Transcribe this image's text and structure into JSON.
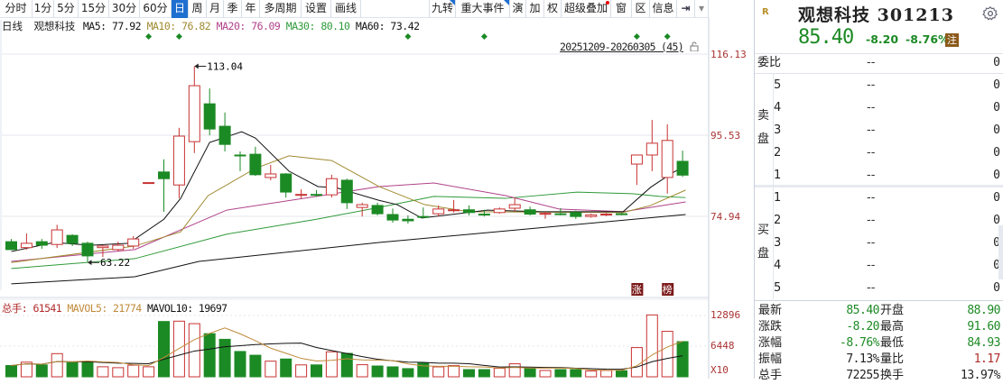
{
  "toolbar": {
    "left": [
      "分时",
      "1分",
      "5分",
      "15分",
      "30分",
      "60分",
      "日",
      "周",
      "月",
      "季",
      "年",
      "多周期",
      "设置",
      "画线"
    ],
    "selected": "日",
    "right": [
      "九转",
      "重大事件",
      "演",
      "加",
      "权",
      "超级叠加",
      "窗",
      "区",
      "信息"
    ],
    "more_icon": "expand-right-icon",
    "dropdown_icon": "chevron-down-icon"
  },
  "legend": {
    "period": "日线",
    "name": "观想科技",
    "ma5": "MA5: 77.92",
    "ma10": "MA10: 76.82",
    "ma20": "MA20: 76.09",
    "ma30": "MA30: 80.10",
    "ma60": "MA60: 73.42"
  },
  "range_label": "20251209-20260305 (45)",
  "colors": {
    "up": "#c83232",
    "down": "#1c8a24",
    "ma5": "#111111",
    "ma10": "#a08a30",
    "ma20": "#b0428a",
    "ma30": "#2f9a3a",
    "ma60": "#111111",
    "accent": "#1e6fd0"
  },
  "chart_data": {
    "type": "candlestick",
    "price_axis": {
      "ticks": [
        "116.13",
        "95.53",
        "74.94"
      ],
      "range": [
        55,
        120
      ]
    },
    "annotations": {
      "high": "113.04",
      "low": "63.22"
    },
    "signal_markers": [
      9,
      11,
      26,
      31,
      41,
      43
    ],
    "badges": [
      {
        "index": 41,
        "text": "涨"
      },
      {
        "index": 43,
        "text": "榜"
      }
    ],
    "ohlc": [
      [
        68.5,
        66.5,
        69.2,
        66.5
      ],
      [
        67.0,
        68.1,
        70.6,
        66.5
      ],
      [
        68.5,
        67.6,
        69.2,
        66.7
      ],
      [
        67.8,
        71.5,
        72.8,
        66.9
      ],
      [
        70.1,
        68.1,
        70.4,
        67.4
      ],
      [
        68.1,
        64.9,
        68.5,
        63.22
      ],
      [
        67.0,
        67.4,
        67.6,
        64.6
      ],
      [
        66.5,
        67.6,
        68.5,
        66.0
      ],
      [
        67.4,
        69.2,
        69.9,
        66.7
      ],
      [
        83.4,
        83.5,
        83.5,
        83.4
      ],
      [
        86.2,
        84.5,
        89.4,
        76.1
      ],
      [
        82.9,
        95.3,
        97.4,
        79.5
      ],
      [
        93.9,
        108.1,
        113.04,
        91.0
      ],
      [
        103.5,
        97.1,
        107.4,
        95.5
      ],
      [
        97.8,
        93.2,
        101.3,
        91.4
      ],
      [
        90.5,
        90.3,
        91.4,
        86.4
      ],
      [
        90.7,
        85.5,
        92.6,
        85.2
      ],
      [
        84.8,
        85.7,
        88.0,
        84.1
      ],
      [
        85.7,
        81.1,
        85.9,
        79.7
      ],
      [
        80.4,
        80.5,
        81.8,
        79.5
      ],
      [
        80.5,
        80.4,
        81.6,
        79.9
      ],
      [
        80.4,
        84.5,
        85.5,
        79.7
      ],
      [
        84.1,
        78.4,
        84.5,
        76.8
      ],
      [
        77.2,
        77.9,
        78.4,
        74.9
      ],
      [
        77.7,
        75.6,
        78.4,
        75.2
      ],
      [
        75.4,
        74.0,
        76.9,
        73.3
      ],
      [
        74.2,
        73.8,
        75.2,
        73.1
      ],
      [
        74.9,
        74.7,
        77.2,
        74.5
      ],
      [
        75.6,
        76.8,
        77.7,
        74.9
      ],
      [
        76.5,
        76.6,
        79.1,
        75.9
      ],
      [
        76.6,
        75.9,
        77.7,
        75.2
      ],
      [
        75.5,
        75.3,
        76.6,
        74.9
      ],
      [
        75.9,
        76.8,
        77.2,
        75.6
      ],
      [
        77.0,
        77.9,
        79.7,
        76.1
      ],
      [
        76.6,
        75.5,
        77.4,
        75.2
      ],
      [
        75.6,
        75.7,
        76.1,
        74.3
      ],
      [
        75.6,
        75.5,
        77.0,
        75.2
      ],
      [
        75.9,
        74.9,
        76.4,
        74.3
      ],
      [
        74.9,
        75.3,
        75.6,
        74.6
      ],
      [
        75.3,
        75.5,
        75.8,
        75.0
      ],
      [
        75.6,
        75.4,
        75.8,
        75.2
      ],
      [
        88.2,
        90.5,
        90.5,
        82.9
      ],
      [
        90.5,
        93.5,
        99.4,
        86.4
      ],
      [
        84.8,
        94.2,
        98.3,
        80.7
      ],
      [
        88.9,
        85.4,
        91.6,
        84.93
      ]
    ],
    "ma_lines": {
      "ma5": [
        [
          0,
          66.0
        ],
        [
          2.8,
          68.3
        ],
        [
          5.2,
          67.6
        ],
        [
          7.7,
          68.1
        ],
        [
          10,
          74.2
        ],
        [
          11.1,
          79.5
        ],
        [
          13,
          93.7
        ],
        [
          15.1,
          96.4
        ],
        [
          16,
          94.8
        ],
        [
          18.2,
          86.4
        ],
        [
          20.1,
          82.5
        ],
        [
          21.3,
          82.2
        ],
        [
          24.1,
          79.0
        ],
        [
          25.3,
          77.9
        ],
        [
          26.9,
          74.5
        ],
        [
          31.2,
          76.5
        ],
        [
          34.8,
          76.1
        ],
        [
          40.1,
          76.1
        ],
        [
          41.9,
          82.3
        ],
        [
          43.3,
          85.9
        ],
        [
          44.2,
          87.8
        ]
      ],
      "ma10": [
        [
          0,
          63.2
        ],
        [
          8.1,
          67.4
        ],
        [
          11.1,
          71.0
        ],
        [
          12.9,
          80.2
        ],
        [
          16,
          87.1
        ],
        [
          18.2,
          90.3
        ],
        [
          21,
          89.1
        ],
        [
          24.1,
          82.5
        ],
        [
          27.1,
          77.9
        ],
        [
          30,
          76.1
        ],
        [
          40.1,
          75.9
        ],
        [
          41.9,
          77.7
        ],
        [
          44.2,
          81.6
        ]
      ],
      "ma20": [
        [
          0,
          63.5
        ],
        [
          8.1,
          66.5
        ],
        [
          14.1,
          76.5
        ],
        [
          20,
          80.0
        ],
        [
          24.1,
          82.5
        ],
        [
          27.7,
          83.4
        ],
        [
          32.4,
          80.2
        ],
        [
          35.9,
          76.8
        ],
        [
          40.1,
          76.1
        ],
        [
          44.2,
          78.6
        ]
      ],
      "ma30": [
        [
          0,
          61.7
        ],
        [
          8.1,
          64.2
        ],
        [
          14.1,
          70.4
        ],
        [
          20,
          74.2
        ],
        [
          24.1,
          77.2
        ],
        [
          27.7,
          80.0
        ],
        [
          32.4,
          79.5
        ],
        [
          37.1,
          81.1
        ],
        [
          40.7,
          80.7
        ],
        [
          42.5,
          80.0
        ],
        [
          44.2,
          79.7
        ]
      ],
      "ma60": [
        [
          0,
          57.8
        ],
        [
          8.1,
          59.6
        ],
        [
          12.3,
          63.5
        ],
        [
          24.1,
          68.3
        ],
        [
          44.2,
          75.4
        ]
      ]
    },
    "volume": {
      "legend": {
        "total_label": "总手: 61541",
        "mavol5": "MAVOL5: 21774",
        "mavol10": "MAVOL10: 19697"
      },
      "axis_ticks": [
        "12896",
        "6448",
        "X10"
      ],
      "max": 13000,
      "values": [
        2345,
        3050,
        2480,
        4830,
        2930,
        3200,
        2090,
        1900,
        2420,
        2090,
        11530,
        11600,
        11080,
        8990,
        7815,
        5275,
        4495,
        3260,
        3710,
        2480,
        2480,
        5210,
        4885,
        2520,
        2250,
        2070,
        1700,
        2820,
        2070,
        2330,
        1500,
        1500,
        1770,
        2710,
        1690,
        1320,
        1500,
        1500,
        1200,
        1320,
        1260,
        6090,
        12900,
        9480,
        7330
      ]
    }
  },
  "quote": {
    "badge": "R",
    "title": "观想科技 301213",
    "price": "85.40",
    "change": "-8.20",
    "change_pct": "-8.76%",
    "tag": "注",
    "weibi_label": "委比",
    "weibi_value": "--",
    "weibi_qty": "0",
    "sell_label": [
      "卖",
      "盘"
    ],
    "buy_label": [
      "买",
      "盘"
    ],
    "sell": [
      {
        "lv": "5",
        "p": "--",
        "q": "0"
      },
      {
        "lv": "4",
        "p": "--",
        "q": "0"
      },
      {
        "lv": "3",
        "p": "--",
        "q": "0"
      },
      {
        "lv": "2",
        "p": "--",
        "q": "0"
      },
      {
        "lv": "1",
        "p": "--",
        "q": "0"
      }
    ],
    "buy": [
      {
        "lv": "1",
        "p": "--",
        "q": "0"
      },
      {
        "lv": "2",
        "p": "--",
        "q": "0"
      },
      {
        "lv": "3",
        "p": "--",
        "q": "0"
      },
      {
        "lv": "4",
        "p": "--",
        "q": "0"
      },
      {
        "lv": "5",
        "p": "--",
        "q": "0"
      }
    ],
    "stats": [
      {
        "k1": "最新",
        "v1": "85.40",
        "c1": "g",
        "k2": "开盘",
        "v2": "88.90",
        "c2": "g"
      },
      {
        "k1": "涨跌",
        "v1": "-8.20",
        "c1": "g",
        "k2": "最高",
        "v2": "91.60",
        "c2": "g"
      },
      {
        "k1": "涨幅",
        "v1": "-8.76%",
        "c1": "g",
        "k2": "最低",
        "v2": "84.93",
        "c2": "g"
      },
      {
        "k1": "振幅",
        "v1": "7.13%",
        "c1": "",
        "k2": "量比",
        "v2": "1.17",
        "c2": "r"
      },
      {
        "k1": "总手",
        "v1": "72255",
        "c1": "",
        "k2": "换手",
        "v2": "13.97%",
        "c2": ""
      }
    ]
  }
}
